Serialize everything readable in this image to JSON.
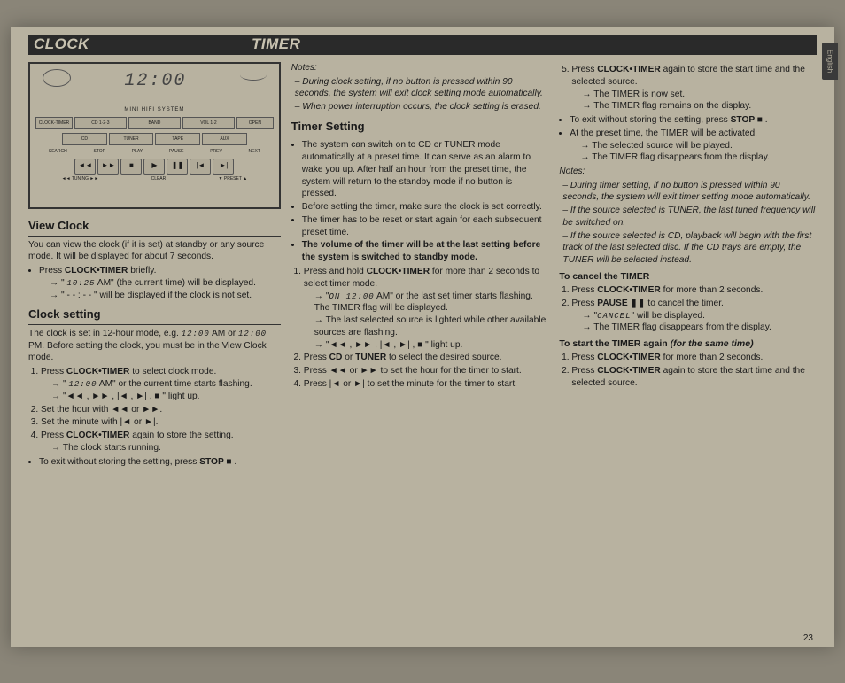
{
  "header": {
    "clock": "CLOCK",
    "timer": "TIMER"
  },
  "diagram": {
    "display": "12:00",
    "label": "MINI HIFI SYSTEM",
    "row1": [
      "CLOCK-TIMER",
      "CD 1·2·3",
      "BAND",
      "VOL 1·2",
      "OPEN"
    ],
    "row2": [
      "CD",
      "TUNER",
      "TAPE",
      "AUX"
    ],
    "tlabels": [
      "SEARCH",
      "",
      "STOP",
      "PLAY",
      "PAUSE",
      "PREV",
      "NEXT"
    ],
    "bottomLabels": [
      "◄◄ TUNING ►►",
      "CLEAR",
      "▼ PRESET ▲"
    ]
  },
  "viewClock": {
    "title": "View Clock",
    "intro": "You can view the clock (if it is set) at standby or any source mode.  It will be displayed for about 7 seconds.",
    "b1a": "Press ",
    "b1b": "CLOCK•TIMER",
    "b1c": " briefly.",
    "r1a": "\" ",
    "r1time": "10:25",
    "r1b": "  AM\" (the current time) will be displayed.",
    "r2": "\" - - : - - \" will be displayed if the clock is not set."
  },
  "clockSetting": {
    "title": "Clock setting",
    "intro1": "The clock is set in 12-hour mode, e.g. ",
    "t1": "12:00",
    "intro2": " AM or ",
    "t2": "12:00",
    "intro3": " PM.  Before setting the clock, you must be in the View Clock mode.",
    "s1a": "Press ",
    "s1b": "CLOCK•TIMER",
    "s1c": " to select clock mode.",
    "s1r1a": "\" ",
    "s1r1t": "12:00",
    "s1r1b": "  AM\" or the current time starts flashing.",
    "s1r2": "\"◄◄ , ►► ,  |◄ ,  ►| ,  ■ \" light up.",
    "s2": "Set the hour with  ◄◄ or ►►.",
    "s3": "Set the minute with  |◄ or ►|.",
    "s4a": "Press ",
    "s4b": "CLOCK•TIMER",
    "s4c": " again to store the setting.",
    "s4r": "The clock starts running.",
    "exitA": "To exit without storing the setting, press ",
    "exitB": "STOP  ■",
    "exitC": " ."
  },
  "col2": {
    "notesTitle": "Notes:",
    "n1": "During clock setting, if no button is pressed within 90 seconds, the system will exit clock setting mode automatically.",
    "n2": "When power interruption occurs, the clock setting is erased.",
    "tsTitle": "Timer Setting",
    "ts1": "The system can switch on to CD or TUNER mode automatically at a preset time. It can serve as an alarm to wake you up. After half an hour from the preset time, the system will return to the standby mode if no button is pressed.",
    "ts2": "Before setting the timer, make sure the clock is set correctly.",
    "ts3": "The timer has to be reset or start again for each subsequent preset time.",
    "ts4": "The volume of the timer will be at the last setting before the system is switched to standby mode.",
    "p1a": "Press and hold ",
    "p1b": "CLOCK•TIMER",
    "p1c": " for more than 2 seconds to select timer mode.",
    "p1r1a": "\"",
    "p1r1t": "ON 12:00",
    "p1r1b": "  AM\" or the last set timer starts flashing. The TIMER flag will be displayed.",
    "p1r2": "The last selected source is lighted while other available sources are flashing.",
    "p1r3": "\"◄◄ , ►► ,  |◄ ,  ►| ,  ■ \" light up.",
    "p2a": "Press ",
    "p2b": "CD",
    "p2c": " or ",
    "p2d": "TUNER",
    "p2e": " to select the desired source.",
    "p3": "Press ◄◄ or ►► to set the hour for the timer to start.",
    "p4": "Press |◄ or ►| to set the minute for the timer to start."
  },
  "col3": {
    "p5a": "Press ",
    "p5b": "CLOCK•TIMER",
    "p5c": " again to store the start time and the selected source.",
    "p5r1": "The TIMER is now set.",
    "p5r2": "The TIMER flag remains on the display.",
    "exitA": "To exit without storing the setting, press ",
    "exitB": "STOP  ■",
    "exitC": " .",
    "at1": "At the preset time, the TIMER will be activated.",
    "at1r1": "The selected source will be played.",
    "at1r2": "The TIMER flag disappears from the display.",
    "notesTitle": "Notes:",
    "n1": "During timer setting, if no button is pressed within 90 seconds, the system will exit timer setting mode automatically.",
    "n2": "If the source selected is TUNER, the last tuned frequency will be switched on.",
    "n3": "If the source selected is CD, playback will begin with the first track of the last selected disc. If the CD trays are empty, the TUNER will be selected instead.",
    "cancelTitle": "To cancel the TIMER",
    "c1a": "Press ",
    "c1b": "CLOCK•TIMER",
    "c1c": " for more than 2 seconds.",
    "c2a": "Press ",
    "c2b": "PAUSE  ❚❚",
    "c2c": "  to cancel the timer.",
    "c2r1a": "\"",
    "c2r1t": "CANCEL",
    "c2r1b": "\" will be displayed.",
    "c2r2": "The TIMER flag disappears from the display.",
    "startTitle": "To start the TIMER again ",
    "startTitleI": "(for the same time)",
    "st1a": "Press ",
    "st1b": "CLOCK•TIMER",
    "st1c": " for more than 2 seconds.",
    "st2a": "Press ",
    "st2b": "CLOCK•TIMER",
    "st2c": " again to store the start time and the selected source."
  },
  "tab": "English",
  "pageNum": "23"
}
